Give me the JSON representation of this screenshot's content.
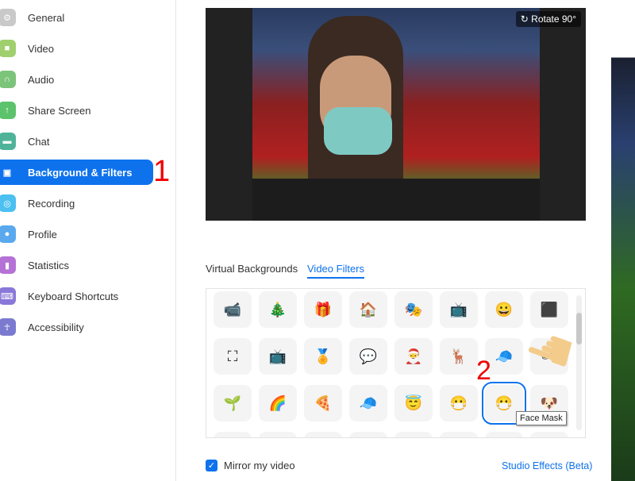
{
  "sidebar": {
    "items": [
      {
        "label": "General",
        "icon": "gear-icon",
        "color": "#c9c9c9",
        "glyph": "⚙"
      },
      {
        "label": "Video",
        "icon": "video-camera-icon",
        "color": "#9fd06d",
        "glyph": "■"
      },
      {
        "label": "Audio",
        "icon": "headphones-icon",
        "color": "#7cc47a",
        "glyph": "∩"
      },
      {
        "label": "Share Screen",
        "icon": "share-screen-icon",
        "color": "#5cc36c",
        "glyph": "↑"
      },
      {
        "label": "Chat",
        "icon": "chat-icon",
        "color": "#4fb39a",
        "glyph": "▬"
      },
      {
        "label": "Background & Filters",
        "icon": "background-icon",
        "color": "#0e72ed",
        "glyph": "▣"
      },
      {
        "label": "Recording",
        "icon": "recording-icon",
        "color": "#4cc0f0",
        "glyph": "◎"
      },
      {
        "label": "Profile",
        "icon": "profile-icon",
        "color": "#5aa9ee",
        "glyph": "●"
      },
      {
        "label": "Statistics",
        "icon": "statistics-icon",
        "color": "#b572d6",
        "glyph": "▮"
      },
      {
        "label": "Keyboard Shortcuts",
        "icon": "keyboard-icon",
        "color": "#8a78d8",
        "glyph": "⌨"
      },
      {
        "label": "Accessibility",
        "icon": "accessibility-icon",
        "color": "#7a7ad0",
        "glyph": "☥"
      }
    ],
    "active": 5
  },
  "annotations": {
    "step1": "1",
    "step2": "2"
  },
  "preview": {
    "rotate_label": "Rotate 90°"
  },
  "tabs": [
    {
      "label": "Virtual Backgrounds"
    },
    {
      "label": "Video Filters",
      "active": true
    }
  ],
  "filters": [
    [
      "📹",
      "🎄",
      "🎁",
      "🏠",
      "🎭",
      "📺",
      "😀",
      "⬛"
    ],
    [
      "⛶",
      "📺",
      "🏅",
      "💬",
      "🎅",
      "🦌",
      "🧢",
      "🕶"
    ],
    [
      "🌱",
      "🌈",
      "🍕",
      "🧢",
      "😇",
      "😷",
      "😷",
      "🐶"
    ],
    [
      "",
      "",
      "",
      "",
      "",
      "",
      "",
      ""
    ]
  ],
  "selected_filter": {
    "row": 2,
    "col": 6,
    "tooltip": "Face Mask"
  },
  "footer": {
    "mirror_label": "Mirror my video",
    "mirror_checked": true,
    "studio_effects": "Studio Effects (Beta)"
  }
}
